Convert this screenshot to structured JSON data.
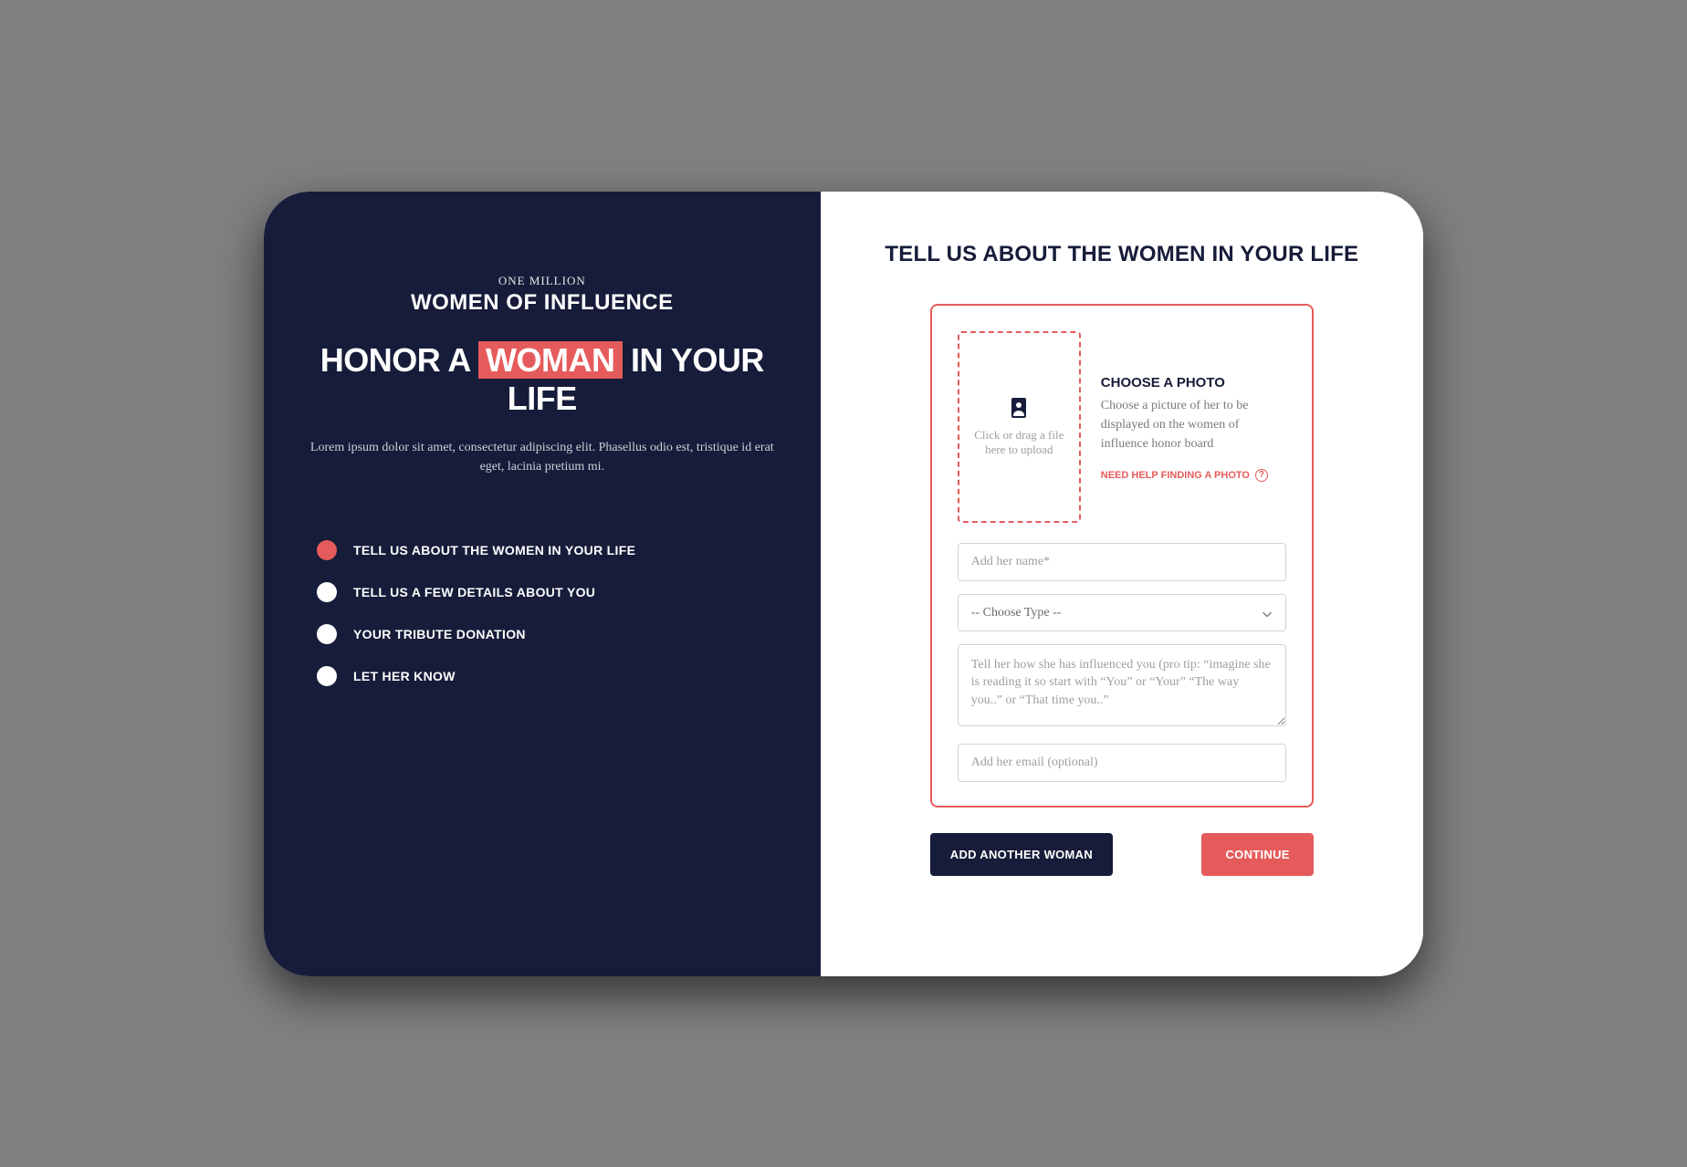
{
  "left": {
    "eyebrow": "ONE MILLION",
    "brand": "WOMEN OF INFLUENCE",
    "headline_pre": "HONOR A ",
    "headline_highlight": "WOMAN",
    "headline_post": " IN YOUR LIFE",
    "description": "Lorem ipsum dolor sit amet, consectetur adipiscing elit. Phasellus odio est, tristique id erat eget, lacinia pretium mi.",
    "steps": [
      {
        "label": "TELL US ABOUT THE WOMEN IN YOUR LIFE",
        "active": true
      },
      {
        "label": "TELL US A FEW DETAILS ABOUT YOU",
        "active": false
      },
      {
        "label": "YOUR TRIBUTE DONATION",
        "active": false
      },
      {
        "label": "LET HER KNOW",
        "active": false
      }
    ]
  },
  "form": {
    "title": "TELL US ABOUT THE WOMEN IN YOUR LIFE",
    "dropzone_text": "Click or drag a file here to upload",
    "photo_heading": "CHOOSE A PHOTO",
    "photo_desc": "Choose a picture of her to be displayed on the women of influence honor board",
    "help_link": "NEED HELP FINDING A PHOTO",
    "name_placeholder": "Add her name*",
    "type_placeholder": "-- Choose Type --",
    "message_placeholder": "Tell her how she has influenced you (pro tip: “imagine she is reading it so start with “You” or “Your” “The way you..” or “That time you..”",
    "email_placeholder": "Add her email (optional)",
    "add_button": "ADD ANOTHER WOMAN",
    "continue_button": "CONTINUE"
  }
}
